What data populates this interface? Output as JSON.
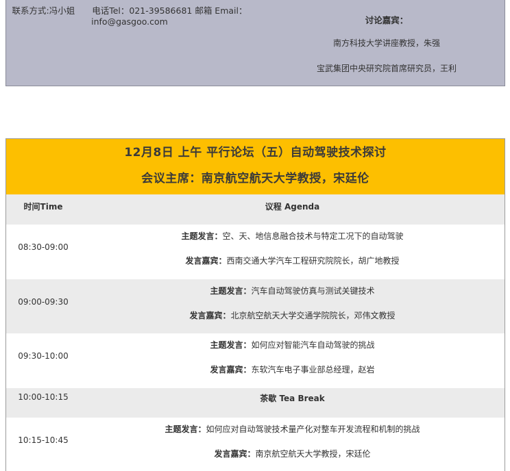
{
  "contact": {
    "line1": "联系方式:冯小姐　　电话Tel：021-39586681 邮箱 Email：",
    "line2": "info@gasgoo.com"
  },
  "discussion": {
    "title": "讨论嘉宾：",
    "guests": [
      "南方科技大学讲座教授，朱强",
      "宝武集团中央研究院首席研究员，王利"
    ]
  },
  "forum": {
    "title": "12月8日 上午 平行论坛（五）自动驾驶技术探讨",
    "chair": "会议主席：南京航空航天大学教授，宋廷伦",
    "header": {
      "time": "时间Time",
      "agenda": "议程 Agenda"
    },
    "rows": [
      {
        "time": "08:30-09:00",
        "topic_label": "主题发言：",
        "topic": "空、天、地信息融合技术与特定工况下的自动驾驶",
        "speaker_label": "发言嘉宾：",
        "speaker": "西南交通大学汽车工程研究院院长，胡广地教授"
      },
      {
        "time": "09:00-09:30",
        "topic_label": "主题发言：",
        "topic": "汽车自动驾驶仿真与测试关键技术",
        "speaker_label": "发言嘉宾：",
        "speaker": "北京航空航天大学交通学院院长，邓伟文教授"
      },
      {
        "time": "09:30-10:00",
        "topic_label": "主题发言：",
        "topic": "如何应对智能汽车自动驾驶的挑战",
        "speaker_label": "发言嘉宾：",
        "speaker": "东软汽车电子事业部总经理，赵岩"
      },
      {
        "time": "10:00-10:15",
        "break": "茶歇 Tea Break"
      },
      {
        "time": "10:15-10:45",
        "topic_label": "主题发言：",
        "topic": "如何应对自动驾驶技术量产化对整车开发流程和机制的挑战",
        "speaker_label": "发言嘉宾：",
        "speaker": "南京航空航天大学教授，宋廷伦"
      }
    ]
  },
  "colors": {
    "info_box_bg": "#b8b9c9",
    "forum_header_bg": "#fdbf00",
    "row_grey": "#ebebeb",
    "row_white": "#ffffff"
  }
}
